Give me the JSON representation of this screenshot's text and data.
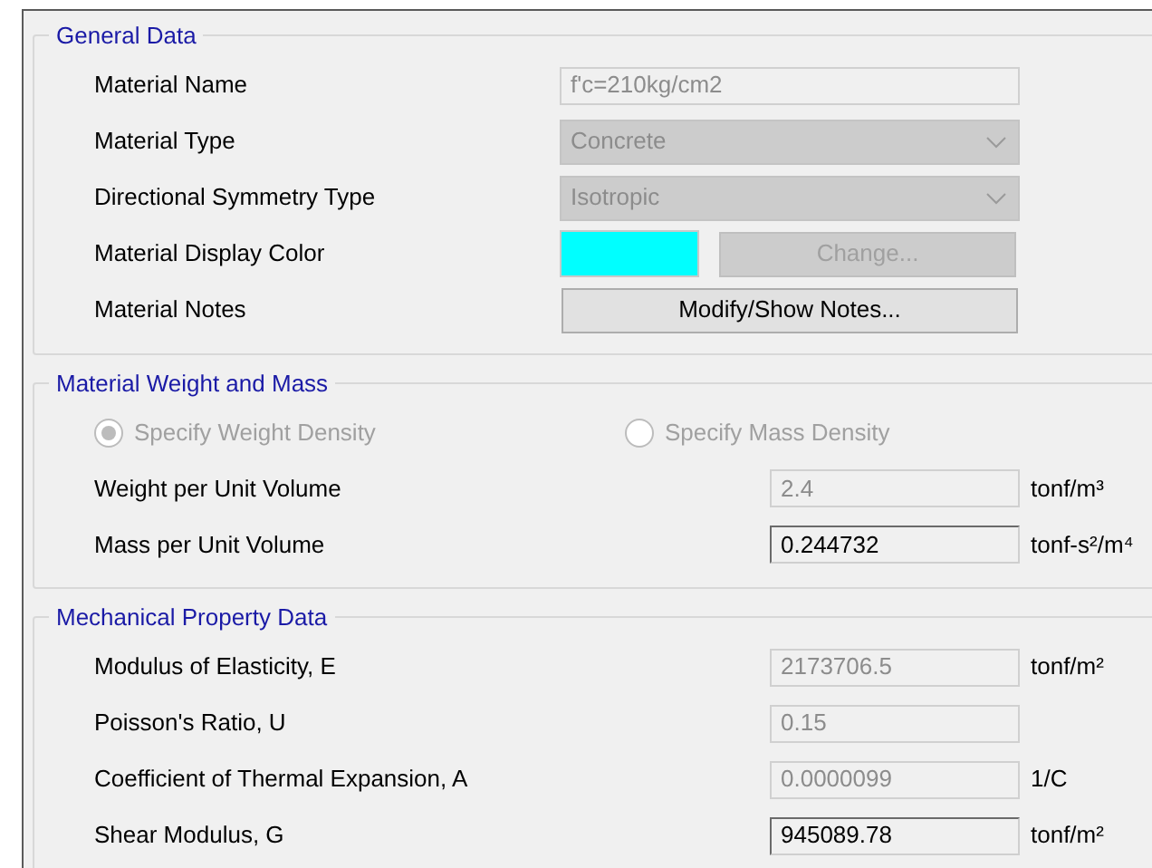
{
  "sections": [
    {
      "title": "General Data",
      "rows": [
        {
          "kind": "text",
          "label": "Material Name",
          "value": "f'c=210kg/cm2",
          "disabled": true
        },
        {
          "kind": "dropdown",
          "label": "Material Type",
          "value": "Concrete",
          "disabled": true
        },
        {
          "kind": "dropdown",
          "label": "Directional Symmetry Type",
          "value": "Isotropic",
          "disabled": true
        },
        {
          "kind": "color",
          "label": "Material Display Color",
          "color": "#00ffff",
          "button": {
            "label": "Change...",
            "disabled": true
          }
        },
        {
          "kind": "button",
          "label": "Material Notes",
          "button": {
            "label": "Modify/Show Notes...",
            "disabled": false
          }
        }
      ]
    },
    {
      "title": "Material Weight and Mass",
      "radios": [
        {
          "label": "Specify Weight Density",
          "selected": true,
          "disabled": true
        },
        {
          "label": "Specify Mass Density",
          "selected": false,
          "disabled": true
        }
      ],
      "rows": [
        {
          "kind": "number",
          "label": "Weight per Unit Volume",
          "value": "2.4",
          "unit": "tonf/m³",
          "disabled": true
        },
        {
          "kind": "number",
          "label": "Mass per Unit Volume",
          "value": "0.244732",
          "unit": "tonf-s²/m⁴",
          "disabled": false
        }
      ]
    },
    {
      "title": "Mechanical Property Data",
      "rows": [
        {
          "kind": "number",
          "label": "Modulus of Elasticity,  E",
          "value": "2173706.5",
          "unit": "tonf/m²",
          "disabled": true
        },
        {
          "kind": "number",
          "label": "Poisson's Ratio,  U",
          "value": "0.15",
          "disabled": true
        },
        {
          "kind": "number",
          "label": "Coefficient of Thermal Expansion,  A",
          "value": "0.0000099",
          "unit": "1/C",
          "disabled": true
        },
        {
          "kind": "number",
          "label": "Shear Modulus,  G",
          "value": "945089.78",
          "unit": "tonf/m²",
          "disabled": false
        }
      ]
    }
  ]
}
